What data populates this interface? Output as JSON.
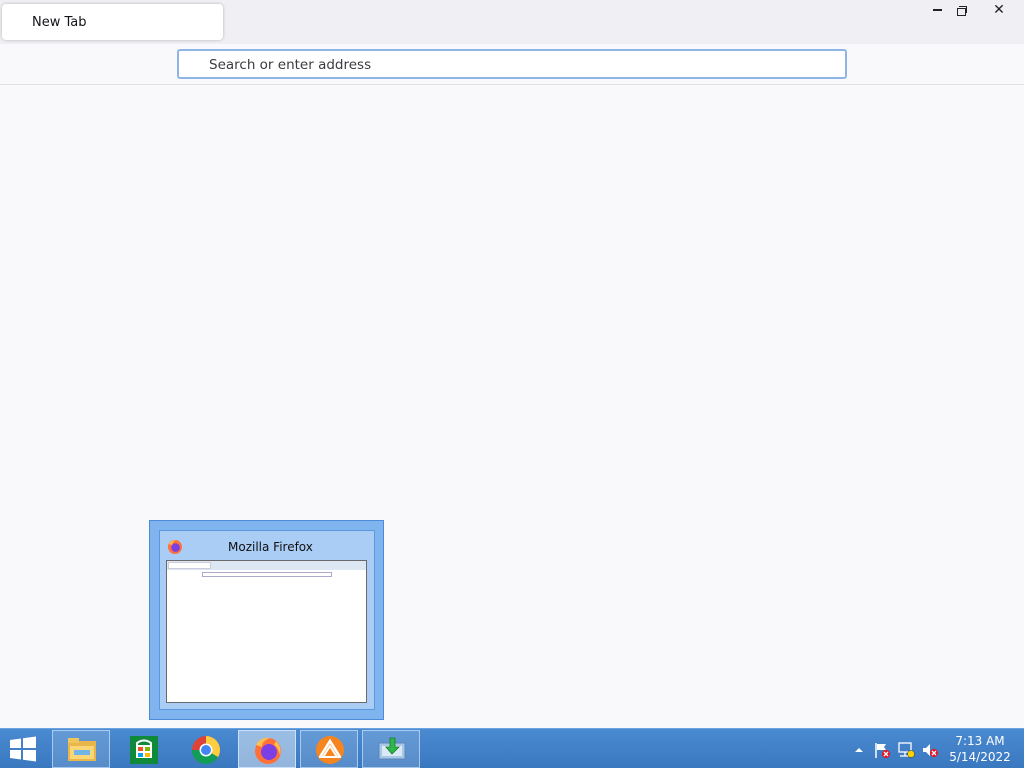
{
  "browser": {
    "tab": {
      "title": "New Tab"
    },
    "window_controls": {
      "minimize": "minimize",
      "maximize": "restore",
      "close": "close"
    },
    "urlbar": {
      "placeholder": "Search or enter address",
      "value": ""
    }
  },
  "preview": {
    "title": "Mozilla Firefox",
    "icon": "firefox-icon"
  },
  "taskbar": {
    "start_icon": "windows-start-icon",
    "apps": [
      {
        "name": "File Explorer",
        "icon": "folder-icon",
        "state": "running"
      },
      {
        "name": "Store",
        "icon": "store-icon",
        "state": "idle"
      },
      {
        "name": "Google Chrome",
        "icon": "chrome-icon",
        "state": "idle"
      },
      {
        "name": "Mozilla Firefox",
        "icon": "firefox-icon",
        "state": "active"
      },
      {
        "name": "App",
        "icon": "fan-app-icon",
        "state": "running"
      },
      {
        "name": "Installer",
        "icon": "installer-icon",
        "state": "running"
      }
    ],
    "tray": {
      "show_hidden": "up-arrow-icon",
      "icons": [
        "action-center-flag-icon",
        "network-icon",
        "volume-muted-icon"
      ]
    },
    "clock": {
      "time": "7:13 AM",
      "date": "5/14/2022"
    }
  },
  "colors": {
    "taskbar": "#3a78c0",
    "url_focus_border": "#8fb4e6",
    "preview_bg": "#7fb4ee"
  }
}
